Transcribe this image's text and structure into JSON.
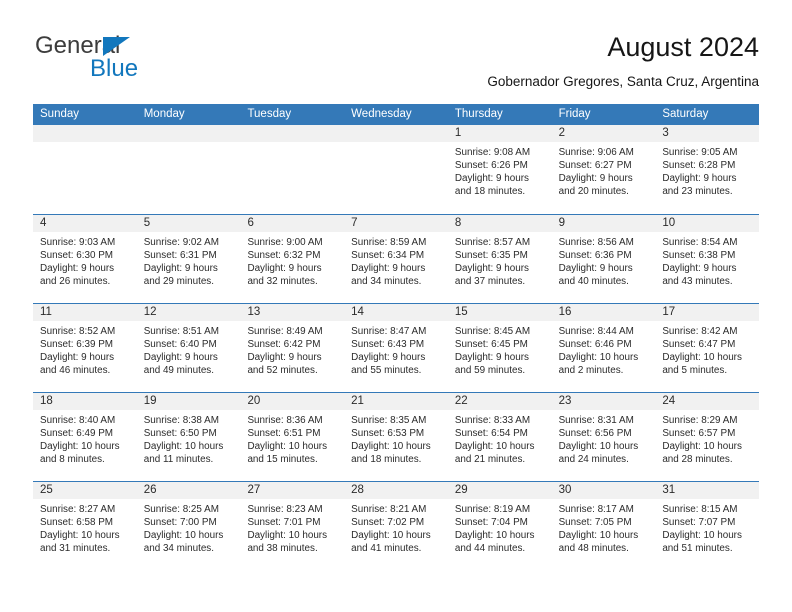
{
  "brand": {
    "name_part1": "General",
    "name_part2": "Blue",
    "flag_icon": "triangle-flag-icon",
    "accent_color": "#1277bd"
  },
  "header": {
    "title": "August 2024",
    "subtitle": "Gobernador Gregores, Santa Cruz, Argentina",
    "header_bg_color": "#3479b8",
    "daynum_bg_color": "#f1f1f1"
  },
  "weekday_headers": [
    "Sunday",
    "Monday",
    "Tuesday",
    "Wednesday",
    "Thursday",
    "Friday",
    "Saturday"
  ],
  "weeks": [
    [
      {
        "day": "",
        "empty": true,
        "lines": []
      },
      {
        "day": "",
        "empty": true,
        "lines": []
      },
      {
        "day": "",
        "empty": true,
        "lines": []
      },
      {
        "day": "",
        "empty": true,
        "lines": []
      },
      {
        "day": "1",
        "empty": false,
        "lines": [
          "Sunrise: 9:08 AM",
          "Sunset: 6:26 PM",
          "Daylight: 9 hours",
          "and 18 minutes."
        ]
      },
      {
        "day": "2",
        "empty": false,
        "lines": [
          "Sunrise: 9:06 AM",
          "Sunset: 6:27 PM",
          "Daylight: 9 hours",
          "and 20 minutes."
        ]
      },
      {
        "day": "3",
        "empty": false,
        "lines": [
          "Sunrise: 9:05 AM",
          "Sunset: 6:28 PM",
          "Daylight: 9 hours",
          "and 23 minutes."
        ]
      }
    ],
    [
      {
        "day": "4",
        "empty": false,
        "lines": [
          "Sunrise: 9:03 AM",
          "Sunset: 6:30 PM",
          "Daylight: 9 hours",
          "and 26 minutes."
        ]
      },
      {
        "day": "5",
        "empty": false,
        "lines": [
          "Sunrise: 9:02 AM",
          "Sunset: 6:31 PM",
          "Daylight: 9 hours",
          "and 29 minutes."
        ]
      },
      {
        "day": "6",
        "empty": false,
        "lines": [
          "Sunrise: 9:00 AM",
          "Sunset: 6:32 PM",
          "Daylight: 9 hours",
          "and 32 minutes."
        ]
      },
      {
        "day": "7",
        "empty": false,
        "lines": [
          "Sunrise: 8:59 AM",
          "Sunset: 6:34 PM",
          "Daylight: 9 hours",
          "and 34 minutes."
        ]
      },
      {
        "day": "8",
        "empty": false,
        "lines": [
          "Sunrise: 8:57 AM",
          "Sunset: 6:35 PM",
          "Daylight: 9 hours",
          "and 37 minutes."
        ]
      },
      {
        "day": "9",
        "empty": false,
        "lines": [
          "Sunrise: 8:56 AM",
          "Sunset: 6:36 PM",
          "Daylight: 9 hours",
          "and 40 minutes."
        ]
      },
      {
        "day": "10",
        "empty": false,
        "lines": [
          "Sunrise: 8:54 AM",
          "Sunset: 6:38 PM",
          "Daylight: 9 hours",
          "and 43 minutes."
        ]
      }
    ],
    [
      {
        "day": "11",
        "empty": false,
        "lines": [
          "Sunrise: 8:52 AM",
          "Sunset: 6:39 PM",
          "Daylight: 9 hours",
          "and 46 minutes."
        ]
      },
      {
        "day": "12",
        "empty": false,
        "lines": [
          "Sunrise: 8:51 AM",
          "Sunset: 6:40 PM",
          "Daylight: 9 hours",
          "and 49 minutes."
        ]
      },
      {
        "day": "13",
        "empty": false,
        "lines": [
          "Sunrise: 8:49 AM",
          "Sunset: 6:42 PM",
          "Daylight: 9 hours",
          "and 52 minutes."
        ]
      },
      {
        "day": "14",
        "empty": false,
        "lines": [
          "Sunrise: 8:47 AM",
          "Sunset: 6:43 PM",
          "Daylight: 9 hours",
          "and 55 minutes."
        ]
      },
      {
        "day": "15",
        "empty": false,
        "lines": [
          "Sunrise: 8:45 AM",
          "Sunset: 6:45 PM",
          "Daylight: 9 hours",
          "and 59 minutes."
        ]
      },
      {
        "day": "16",
        "empty": false,
        "lines": [
          "Sunrise: 8:44 AM",
          "Sunset: 6:46 PM",
          "Daylight: 10 hours",
          "and 2 minutes."
        ]
      },
      {
        "day": "17",
        "empty": false,
        "lines": [
          "Sunrise: 8:42 AM",
          "Sunset: 6:47 PM",
          "Daylight: 10 hours",
          "and 5 minutes."
        ]
      }
    ],
    [
      {
        "day": "18",
        "empty": false,
        "lines": [
          "Sunrise: 8:40 AM",
          "Sunset: 6:49 PM",
          "Daylight: 10 hours",
          "and 8 minutes."
        ]
      },
      {
        "day": "19",
        "empty": false,
        "lines": [
          "Sunrise: 8:38 AM",
          "Sunset: 6:50 PM",
          "Daylight: 10 hours",
          "and 11 minutes."
        ]
      },
      {
        "day": "20",
        "empty": false,
        "lines": [
          "Sunrise: 8:36 AM",
          "Sunset: 6:51 PM",
          "Daylight: 10 hours",
          "and 15 minutes."
        ]
      },
      {
        "day": "21",
        "empty": false,
        "lines": [
          "Sunrise: 8:35 AM",
          "Sunset: 6:53 PM",
          "Daylight: 10 hours",
          "and 18 minutes."
        ]
      },
      {
        "day": "22",
        "empty": false,
        "lines": [
          "Sunrise: 8:33 AM",
          "Sunset: 6:54 PM",
          "Daylight: 10 hours",
          "and 21 minutes."
        ]
      },
      {
        "day": "23",
        "empty": false,
        "lines": [
          "Sunrise: 8:31 AM",
          "Sunset: 6:56 PM",
          "Daylight: 10 hours",
          "and 24 minutes."
        ]
      },
      {
        "day": "24",
        "empty": false,
        "lines": [
          "Sunrise: 8:29 AM",
          "Sunset: 6:57 PM",
          "Daylight: 10 hours",
          "and 28 minutes."
        ]
      }
    ],
    [
      {
        "day": "25",
        "empty": false,
        "lines": [
          "Sunrise: 8:27 AM",
          "Sunset: 6:58 PM",
          "Daylight: 10 hours",
          "and 31 minutes."
        ]
      },
      {
        "day": "26",
        "empty": false,
        "lines": [
          "Sunrise: 8:25 AM",
          "Sunset: 7:00 PM",
          "Daylight: 10 hours",
          "and 34 minutes."
        ]
      },
      {
        "day": "27",
        "empty": false,
        "lines": [
          "Sunrise: 8:23 AM",
          "Sunset: 7:01 PM",
          "Daylight: 10 hours",
          "and 38 minutes."
        ]
      },
      {
        "day": "28",
        "empty": false,
        "lines": [
          "Sunrise: 8:21 AM",
          "Sunset: 7:02 PM",
          "Daylight: 10 hours",
          "and 41 minutes."
        ]
      },
      {
        "day": "29",
        "empty": false,
        "lines": [
          "Sunrise: 8:19 AM",
          "Sunset: 7:04 PM",
          "Daylight: 10 hours",
          "and 44 minutes."
        ]
      },
      {
        "day": "30",
        "empty": false,
        "lines": [
          "Sunrise: 8:17 AM",
          "Sunset: 7:05 PM",
          "Daylight: 10 hours",
          "and 48 minutes."
        ]
      },
      {
        "day": "31",
        "empty": false,
        "lines": [
          "Sunrise: 8:15 AM",
          "Sunset: 7:07 PM",
          "Daylight: 10 hours",
          "and 51 minutes."
        ]
      }
    ]
  ]
}
